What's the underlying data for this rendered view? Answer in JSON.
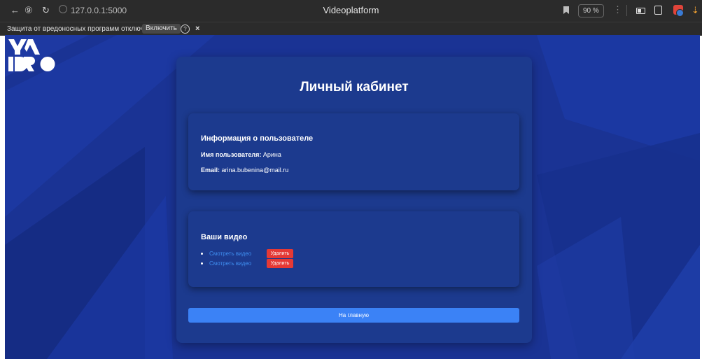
{
  "browser": {
    "url": "127.0.0.1:5000",
    "window_title": "Videoplatform",
    "zoom": "90 %",
    "back_glyph": "←",
    "forward_glyph": "⑨",
    "reload_glyph": "↻",
    "menu_glyph": "⋮",
    "download_glyph": "⇣"
  },
  "infobar": {
    "message": "Защита от вредоносных программ отключена",
    "enable_label": "Включить",
    "help_glyph": "?",
    "close_glyph": "×"
  },
  "page": {
    "title": "Личный кабинет",
    "user_info": {
      "heading": "Информация о пользователе",
      "username_label": "Имя пользователя:",
      "username_value": "Арина",
      "email_label": "Email:",
      "email_value": "arina.bubenina@mail.ru"
    },
    "videos": {
      "heading": "Ваши видео",
      "items": [
        {
          "link": "Смотреть видео",
          "delete": "Удалить"
        },
        {
          "link": "Смотреть видео",
          "delete": "Удалить"
        }
      ]
    },
    "home_button": "На главную"
  },
  "colors": {
    "background": "#1a3394",
    "panel": "#1c3a8e",
    "primary": "#3b82f6",
    "danger": "#e53935",
    "link": "#3f8ef0"
  }
}
